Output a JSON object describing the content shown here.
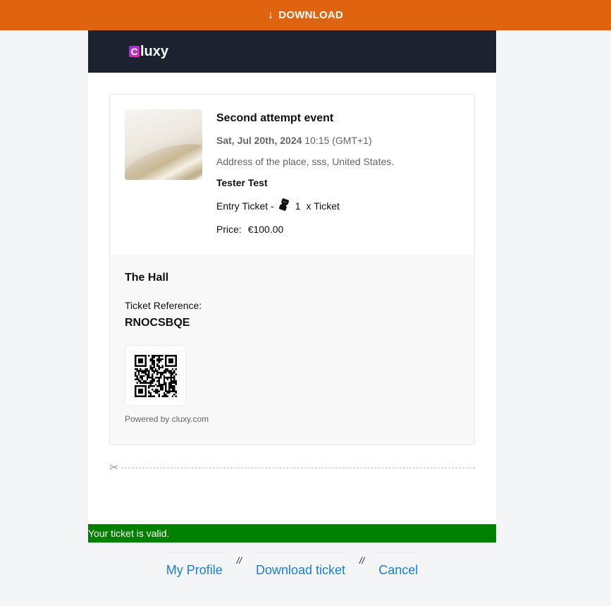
{
  "topbar": {
    "download_label": "DOWNLOAD",
    "icon": "arrow-down-icon"
  },
  "brand": {
    "logo_letter": "C",
    "logo_rest": "luxy",
    "logo_colors": [
      "#8b2cf5",
      "#e62f9b"
    ]
  },
  "event": {
    "title": "Second attempt event",
    "date": "Sat, Jul 20th, 2024",
    "time": "10:15 (GMT+1)",
    "address": "Address of the place, sss, United States.",
    "attendee": "Tester Test",
    "ticket_type": "Entry Ticket -",
    "ticket_icon": "ticket-icon",
    "quantity": "1",
    "quantity_label": "x Ticket",
    "price_label": "Price:",
    "price": "€100.00"
  },
  "ticket": {
    "hall": "The Hall",
    "reference_label": "Ticket Reference:",
    "reference": "RNOCSBQE",
    "powered_by": "Powered by cluxy.com"
  },
  "status": {
    "message": "Your ticket is valid.",
    "color": "#008000"
  },
  "footer": {
    "links": [
      "My Profile",
      "Download ticket",
      "Cancel"
    ],
    "separator": "//"
  },
  "colors": {
    "accent": "#e06410",
    "header_bg": "#1c2230",
    "link": "#1a7fd4"
  }
}
